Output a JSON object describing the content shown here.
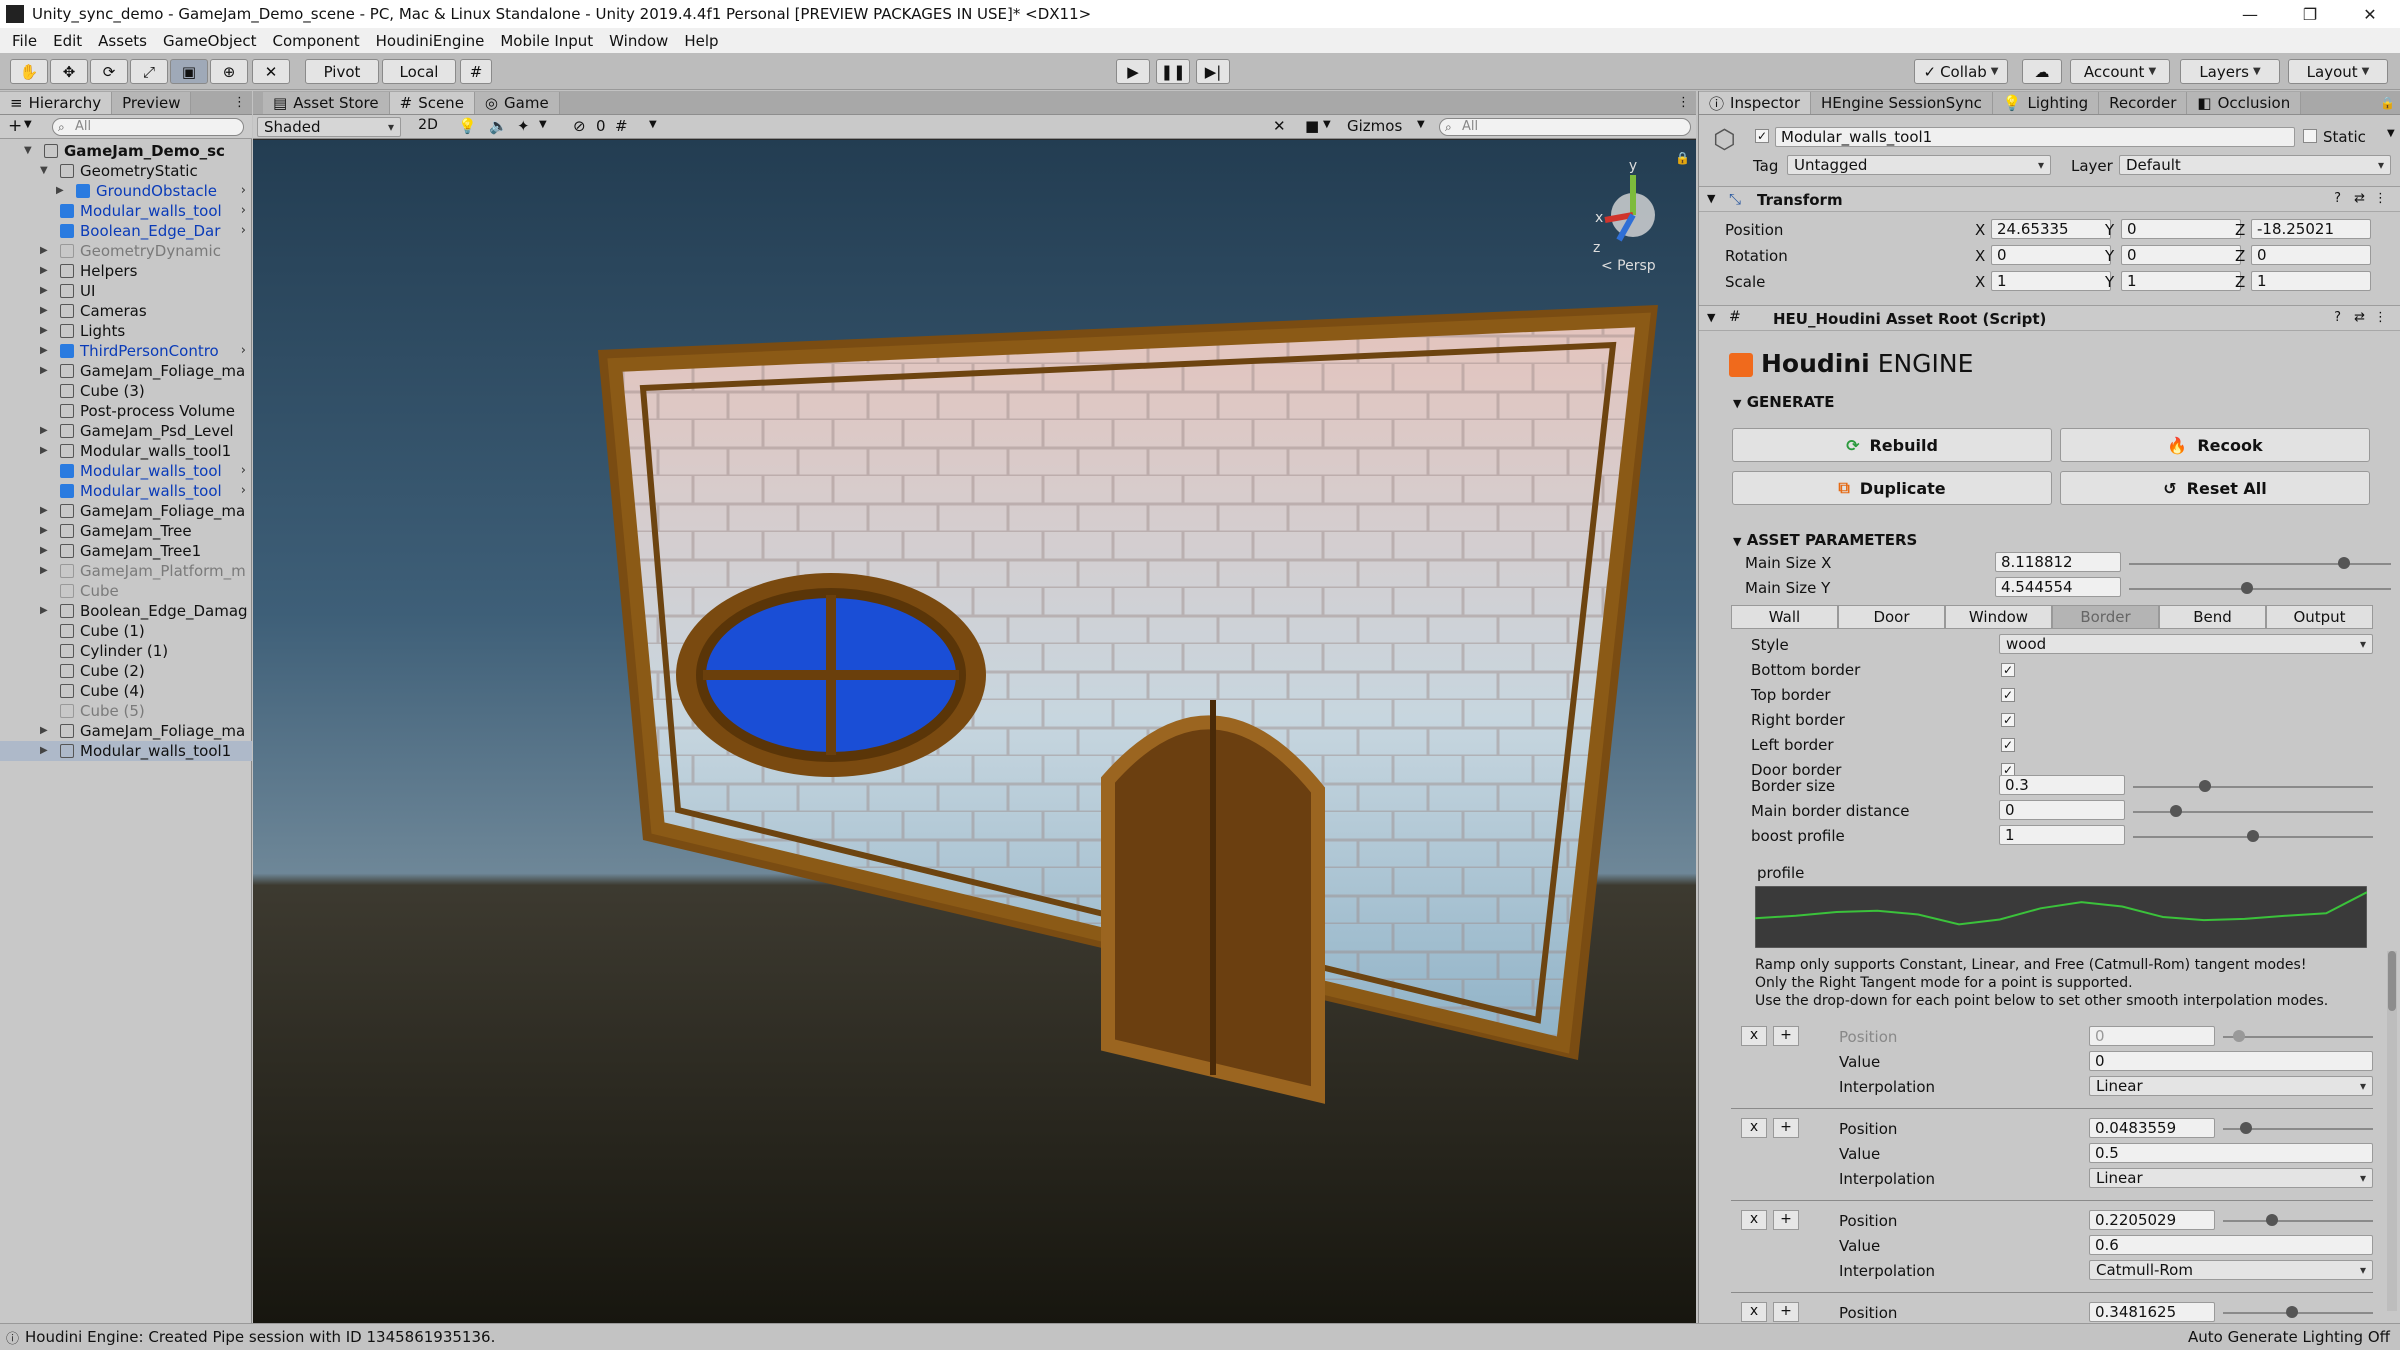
{
  "window": {
    "title": "Unity_sync_demo - GameJam_Demo_scene - PC, Mac & Linux Standalone - Unity 2019.4.4f1 Personal [PREVIEW PACKAGES IN USE]* <DX11>",
    "minimize": "—",
    "maximize": "❐",
    "close": "✕"
  },
  "menu": [
    "File",
    "Edit",
    "Assets",
    "GameObject",
    "Component",
    "HoudiniEngine",
    "Mobile Input",
    "Window",
    "Help"
  ],
  "toolbar": {
    "pivot": "Pivot",
    "local": "Local",
    "collab": "Collab",
    "account": "Account",
    "layers": "Layers",
    "layout": "Layout"
  },
  "hierarchy": {
    "tabs": [
      "Hierarchy",
      "Preview"
    ],
    "add": "+",
    "search_placeholder": "All",
    "rows": [
      {
        "label": "GameJam_Demo_sc",
        "indent": 0,
        "arrow": "▼",
        "style": "scene"
      },
      {
        "label": "GeometryStatic",
        "indent": 1,
        "arrow": "▼",
        "style": "normal"
      },
      {
        "label": "GroundObstacle",
        "indent": 2,
        "arrow": "▶",
        "style": "blue"
      },
      {
        "label": "Modular_walls_tool",
        "indent": 1,
        "arrow": "",
        "style": "blue"
      },
      {
        "label": "Boolean_Edge_Dar",
        "indent": 1,
        "arrow": "",
        "style": "blue"
      },
      {
        "label": "GeometryDynamic",
        "indent": 1,
        "arrow": "▶",
        "style": "grey"
      },
      {
        "label": "Helpers",
        "indent": 1,
        "arrow": "▶",
        "style": "normal"
      },
      {
        "label": "UI",
        "indent": 1,
        "arrow": "▶",
        "style": "normal"
      },
      {
        "label": "Cameras",
        "indent": 1,
        "arrow": "▶",
        "style": "normal"
      },
      {
        "label": "Lights",
        "indent": 1,
        "arrow": "▶",
        "style": "normal"
      },
      {
        "label": "ThirdPersonContro",
        "indent": 1,
        "arrow": "▶",
        "style": "blue"
      },
      {
        "label": "GameJam_Foliage_ma",
        "indent": 1,
        "arrow": "▶",
        "style": "normal"
      },
      {
        "label": "Cube (3)",
        "indent": 1,
        "arrow": "",
        "style": "normal"
      },
      {
        "label": "Post-process Volume",
        "indent": 1,
        "arrow": "",
        "style": "normal"
      },
      {
        "label": "GameJam_Psd_Level",
        "indent": 1,
        "arrow": "▶",
        "style": "normal"
      },
      {
        "label": "Modular_walls_tool1",
        "indent": 1,
        "arrow": "▶",
        "style": "normal"
      },
      {
        "label": "Modular_walls_tool",
        "indent": 1,
        "arrow": "",
        "style": "blue"
      },
      {
        "label": "Modular_walls_tool",
        "indent": 1,
        "arrow": "",
        "style": "blue"
      },
      {
        "label": "GameJam_Foliage_ma",
        "indent": 1,
        "arrow": "▶",
        "style": "normal"
      },
      {
        "label": "GameJam_Tree",
        "indent": 1,
        "arrow": "▶",
        "style": "normal"
      },
      {
        "label": "GameJam_Tree1",
        "indent": 1,
        "arrow": "▶",
        "style": "normal"
      },
      {
        "label": "GameJam_Platform_m",
        "indent": 1,
        "arrow": "▶",
        "style": "grey"
      },
      {
        "label": "Cube",
        "indent": 1,
        "arrow": "",
        "style": "grey"
      },
      {
        "label": "Boolean_Edge_Damag",
        "indent": 1,
        "arrow": "▶",
        "style": "normal"
      },
      {
        "label": "Cube (1)",
        "indent": 1,
        "arrow": "",
        "style": "normal"
      },
      {
        "label": "Cylinder (1)",
        "indent": 1,
        "arrow": "",
        "style": "normal"
      },
      {
        "label": "Cube (2)",
        "indent": 1,
        "arrow": "",
        "style": "normal"
      },
      {
        "label": "Cube (4)",
        "indent": 1,
        "arrow": "",
        "style": "normal"
      },
      {
        "label": "Cube (5)",
        "indent": 1,
        "arrow": "",
        "style": "grey"
      },
      {
        "label": "GameJam_Foliage_ma",
        "indent": 1,
        "arrow": "▶",
        "style": "normal"
      },
      {
        "label": "Modular_walls_tool1",
        "indent": 1,
        "arrow": "▶",
        "style": "selected"
      }
    ]
  },
  "scene": {
    "tabs": [
      "Asset Store",
      "Scene",
      "Game"
    ],
    "shading": "Shaded",
    "mode2d": "2D",
    "fx_count": "0",
    "gizmos": "Gizmos",
    "search_placeholder": "All",
    "persp": "< Persp",
    "axis_y": "y",
    "axis_x": "x",
    "axis_z": "z"
  },
  "inspector": {
    "tabs": [
      "Inspector",
      "HEngine SessionSync",
      "Lighting",
      "Recorder",
      "Occlusion"
    ],
    "object_name": "Modular_walls_tool1",
    "static_label": "Static",
    "tag_label": "Tag",
    "tag_value": "Untagged",
    "layer_label": "Layer",
    "layer_value": "Default",
    "transform": {
      "title": "Transform",
      "rows": [
        {
          "label": "Position",
          "x": "24.65335",
          "y": "0",
          "z": "-18.25021"
        },
        {
          "label": "Rotation",
          "x": "0",
          "y": "0",
          "z": "0"
        },
        {
          "label": "Scale",
          "x": "1",
          "y": "1",
          "z": "1"
        }
      ],
      "x_label": "X",
      "y_label": "Y",
      "z_label": "Z"
    },
    "heu": {
      "title": "HEU_Houdini Asset Root (Script)",
      "logo_text_1": "Houdini",
      "logo_text_2": "ENGINE",
      "generate_label": "GENERATE",
      "buttons": [
        "Rebuild",
        "Recook",
        "Duplicate",
        "Reset All"
      ],
      "asset_params_label": "ASSET PARAMETERS",
      "main_size_x_label": "Main Size X",
      "main_size_x": "8.118812",
      "main_size_x_level": 0.82,
      "main_size_y_label": "Main Size Y",
      "main_size_y": "4.544554",
      "main_size_y_level": 0.45,
      "param_tabs": [
        "Wall",
        "Door",
        "Window",
        "Border",
        "Bend",
        "Output"
      ],
      "active_tab": "Border",
      "style_label": "Style",
      "style_value": "wood",
      "checks": [
        {
          "label": "Bottom border",
          "checked": true
        },
        {
          "label": "Top border",
          "checked": true
        },
        {
          "label": "Right border",
          "checked": true
        },
        {
          "label": "Left border",
          "checked": true
        },
        {
          "label": "Door border",
          "checked": true
        }
      ],
      "border_size_label": "Border size",
      "border_size": "0.3",
      "border_size_level": 0.3,
      "main_border_label": "Main border distance",
      "main_border": "0",
      "main_border_level": 0.18,
      "boost_label": "boost profile",
      "boost": "1",
      "boost_level": 0.5,
      "profile_label": "profile",
      "profile_curve": [
        0.52,
        0.48,
        0.42,
        0.4,
        0.46,
        0.62,
        0.54,
        0.36,
        0.26,
        0.33,
        0.5,
        0.55,
        0.53,
        0.48,
        0.44,
        0.1
      ],
      "ramp_note_1": "Ramp only supports Constant, Linear, and Free (Catmull-Rom) tangent modes!",
      "ramp_note_2": "Only the Right Tangent mode for a point is supported.",
      "ramp_note_3": "Use the drop-down for each point below to set other smooth interpolation modes.",
      "x_btn": "x",
      "plus_btn": "+",
      "position_label": "Position",
      "value_label": "Value",
      "interp_label": "Interpolation",
      "points": [
        {
          "position": "0",
          "value": "0",
          "interpolation": "Linear",
          "level": 0.0,
          "disabled": true
        },
        {
          "position": "0.0483559",
          "value": "0.5",
          "interpolation": "Linear",
          "level": 0.048,
          "disabled": false
        },
        {
          "position": "0.2205029",
          "value": "0.6",
          "interpolation": "Catmull-Rom",
          "level": 0.22,
          "disabled": false
        },
        {
          "position": "0.3481625",
          "value": "",
          "interpolation": "",
          "level": 0.35,
          "disabled": false
        }
      ]
    }
  },
  "status": {
    "message": "Houdini Engine: Created Pipe session with ID 1345861935136.",
    "right": "Auto Generate Lighting Off"
  }
}
